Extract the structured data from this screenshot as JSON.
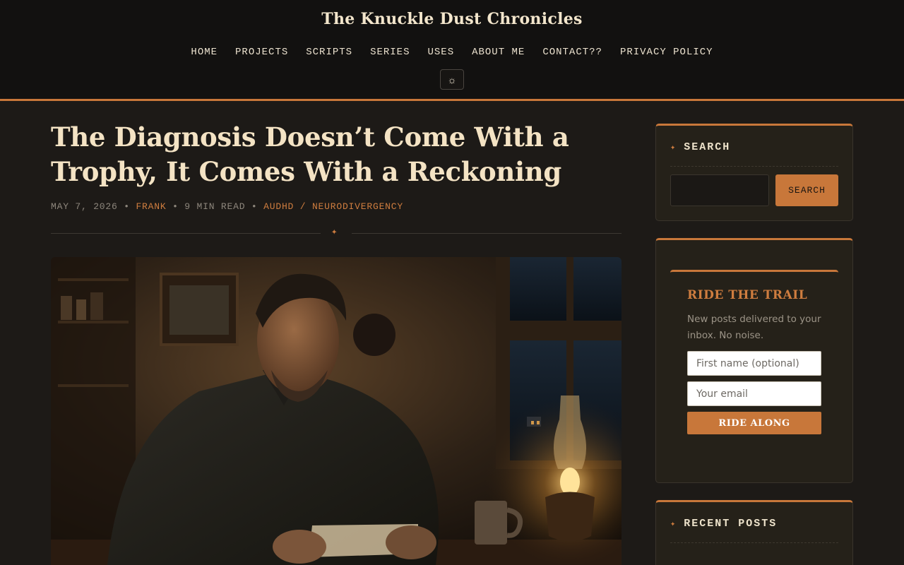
{
  "site": {
    "title": "The Knuckle Dust Chronicles"
  },
  "nav": {
    "items": [
      {
        "label": "HOME"
      },
      {
        "label": "PROJECTS"
      },
      {
        "label": "SCRIPTS"
      },
      {
        "label": "SERIES"
      },
      {
        "label": "USES"
      },
      {
        "label": "ABOUT ME"
      },
      {
        "label": "CONTACT??"
      },
      {
        "label": "PRIVACY POLICY"
      }
    ],
    "theme_toggle_icon": "☼"
  },
  "post": {
    "title": "The Diagnosis Doesn’t Come With a Trophy, It Comes With a Reckoning",
    "date": "MAY 7, 2026",
    "author": "FRANK",
    "read_time": "9 MIN READ",
    "categories": "AUDHD / NEURODIVERGENCY",
    "separator": "•",
    "divider_glyph": "✦"
  },
  "sidebar": {
    "search": {
      "title": "SEARCH",
      "input_placeholder": "",
      "button_label": "SEARCH"
    },
    "newsletter": {
      "title": "RIDE THE TRAIL",
      "description": "New posts delivered to your inbox. No noise.",
      "first_name_placeholder": "First name (optional)",
      "email_placeholder": "Your email",
      "button_label": "RIDE ALONG"
    },
    "recent_posts": {
      "title": "RECENT POSTS"
    },
    "title_glyph": "✦"
  },
  "colors": {
    "accent": "#c8773a",
    "header_bg": "#121110",
    "page_bg": "#1d1a17",
    "widget_bg": "#252119"
  }
}
